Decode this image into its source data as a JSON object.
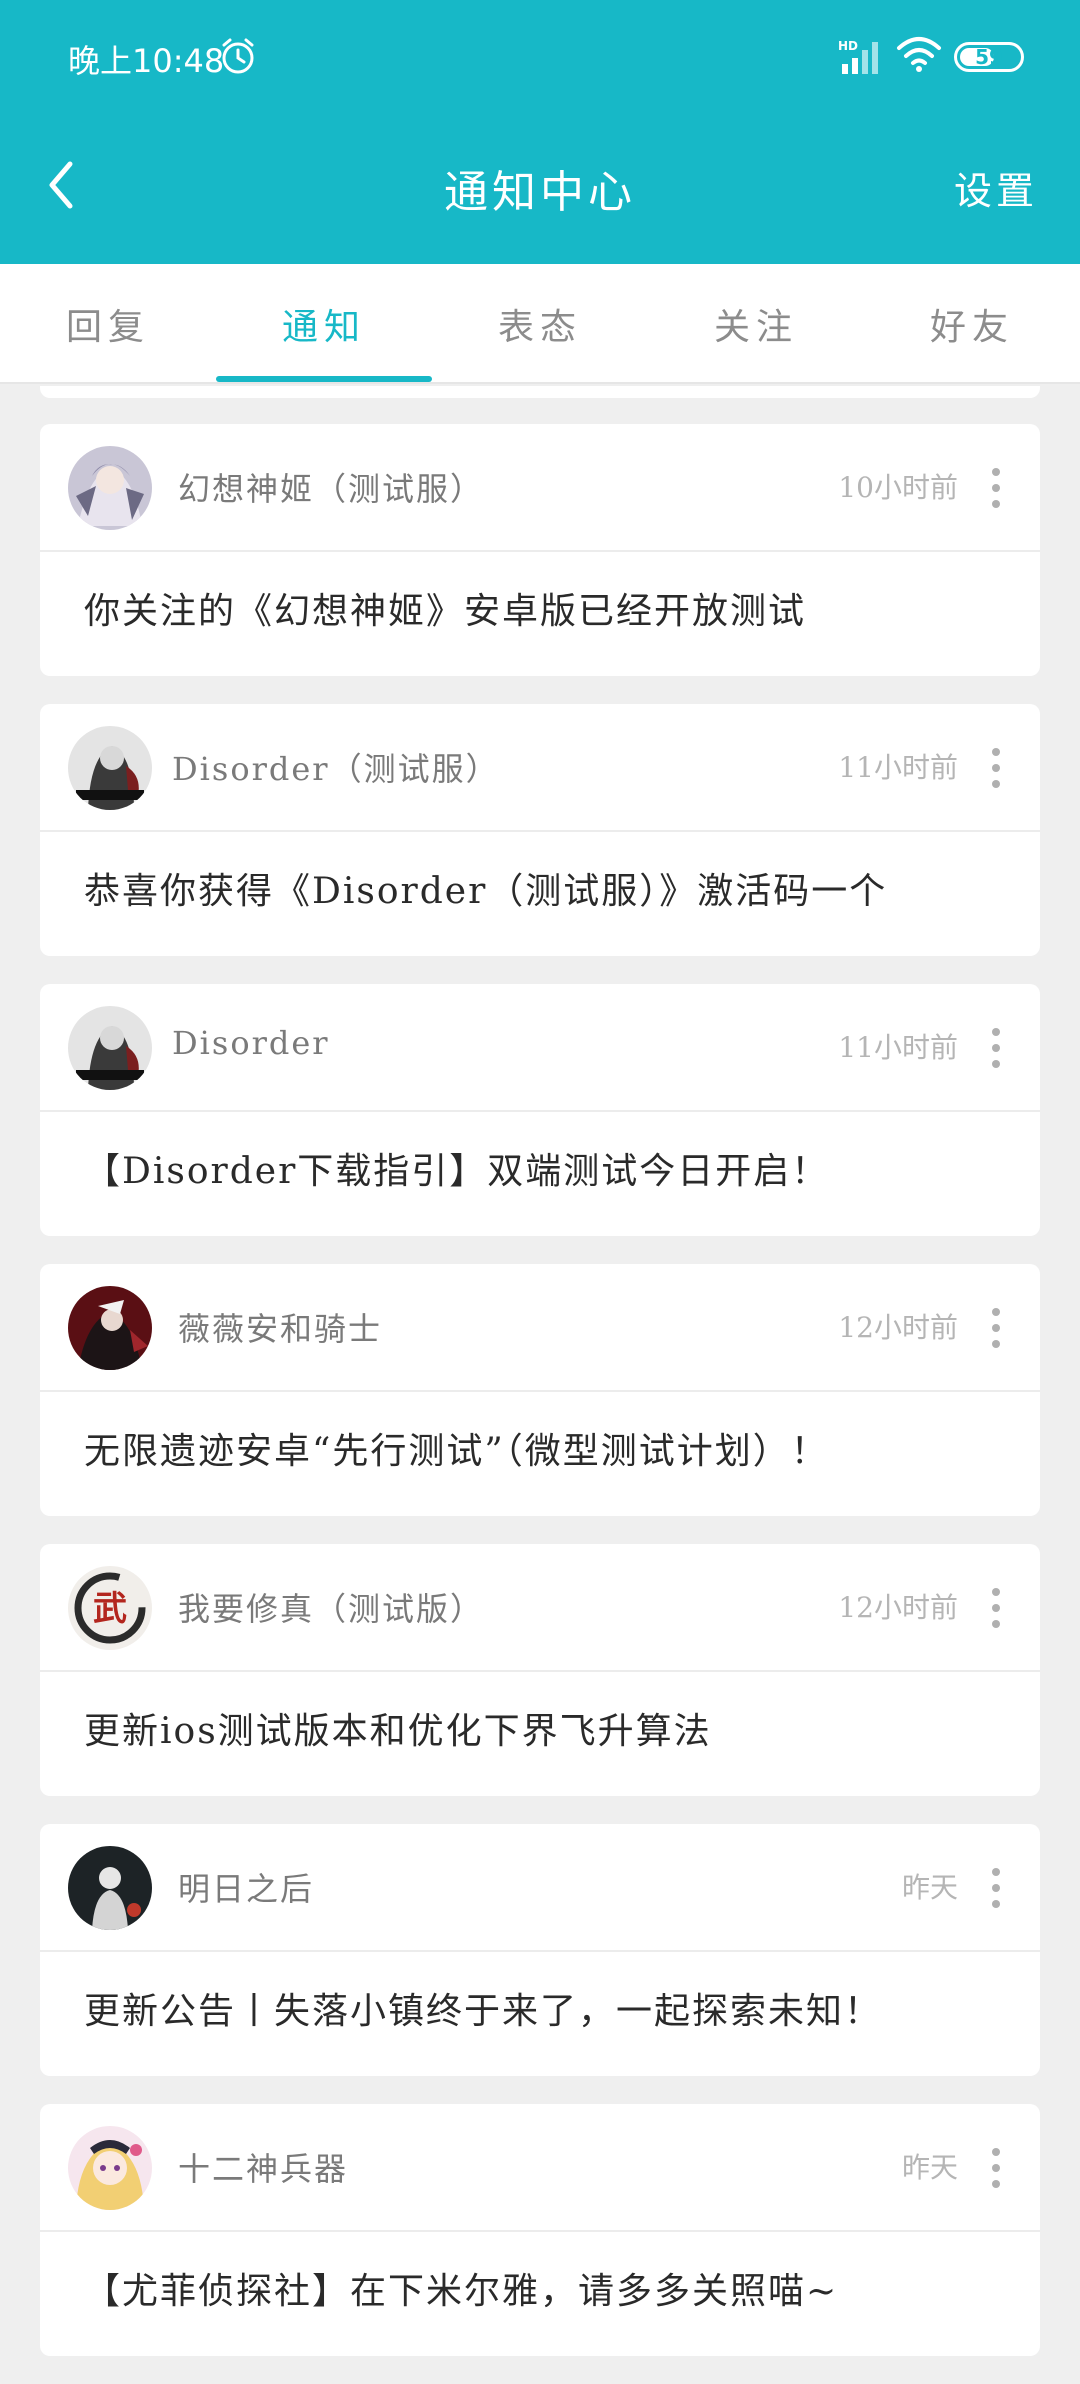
{
  "status_bar": {
    "time": "晚上10:48",
    "battery": "59",
    "battery_level": 0.59,
    "network": "HD",
    "icons": [
      "alarm-icon",
      "signal-icon",
      "wifi-icon",
      "battery-icon"
    ]
  },
  "header": {
    "title": "通知中心",
    "settings_label": "设置",
    "back_icon": "chevron-left-icon"
  },
  "tabs": [
    {
      "label": "回复",
      "active": false
    },
    {
      "label": "通知",
      "active": true
    },
    {
      "label": "表态",
      "active": false
    },
    {
      "label": "关注",
      "active": false
    },
    {
      "label": "好友",
      "active": false
    }
  ],
  "notifications": [
    {
      "sender": "幻想神姬（测试服）",
      "time": "10小时前",
      "message": "你关注的《幻想神姬》安卓版已经开放测试",
      "avatar": "anime-girl-avatar"
    },
    {
      "sender": "Disorder（测试服）",
      "time": "11小时前",
      "message": "恭喜你获得《Disorder（测试服）》激活码一个",
      "avatar": "disorder-avatar"
    },
    {
      "sender": "Disorder",
      "time": "11小时前",
      "message": "【Disorder下载指引】双端测试今日开启！",
      "avatar": "disorder-avatar"
    },
    {
      "sender": "薇薇安和骑士",
      "time": "12小时前",
      "message": "无限遗迹安卓“先行测试”（微型测试计划）！",
      "avatar": "knight-avatar"
    },
    {
      "sender": "我要修真（测试版）",
      "time": "12小时前",
      "message": "更新ios测试版本和优化下界飞升算法",
      "avatar": "ink-seal-avatar",
      "avatar_glyph": "武"
    },
    {
      "sender": "明日之后",
      "time": "昨天",
      "message": "更新公告丨失落小镇终于来了，一起探索未知！",
      "avatar": "silhouette-avatar"
    },
    {
      "sender": "十二神兵器",
      "time": "昨天",
      "message": "【尤菲侦探社】在下米尔雅，请多多关照喵~",
      "avatar": "blonde-girl-avatar"
    }
  ],
  "colors": {
    "accent": "#17b8c7",
    "background": "#efefef",
    "card": "#ffffff",
    "muted_text": "#8c8c8c"
  }
}
